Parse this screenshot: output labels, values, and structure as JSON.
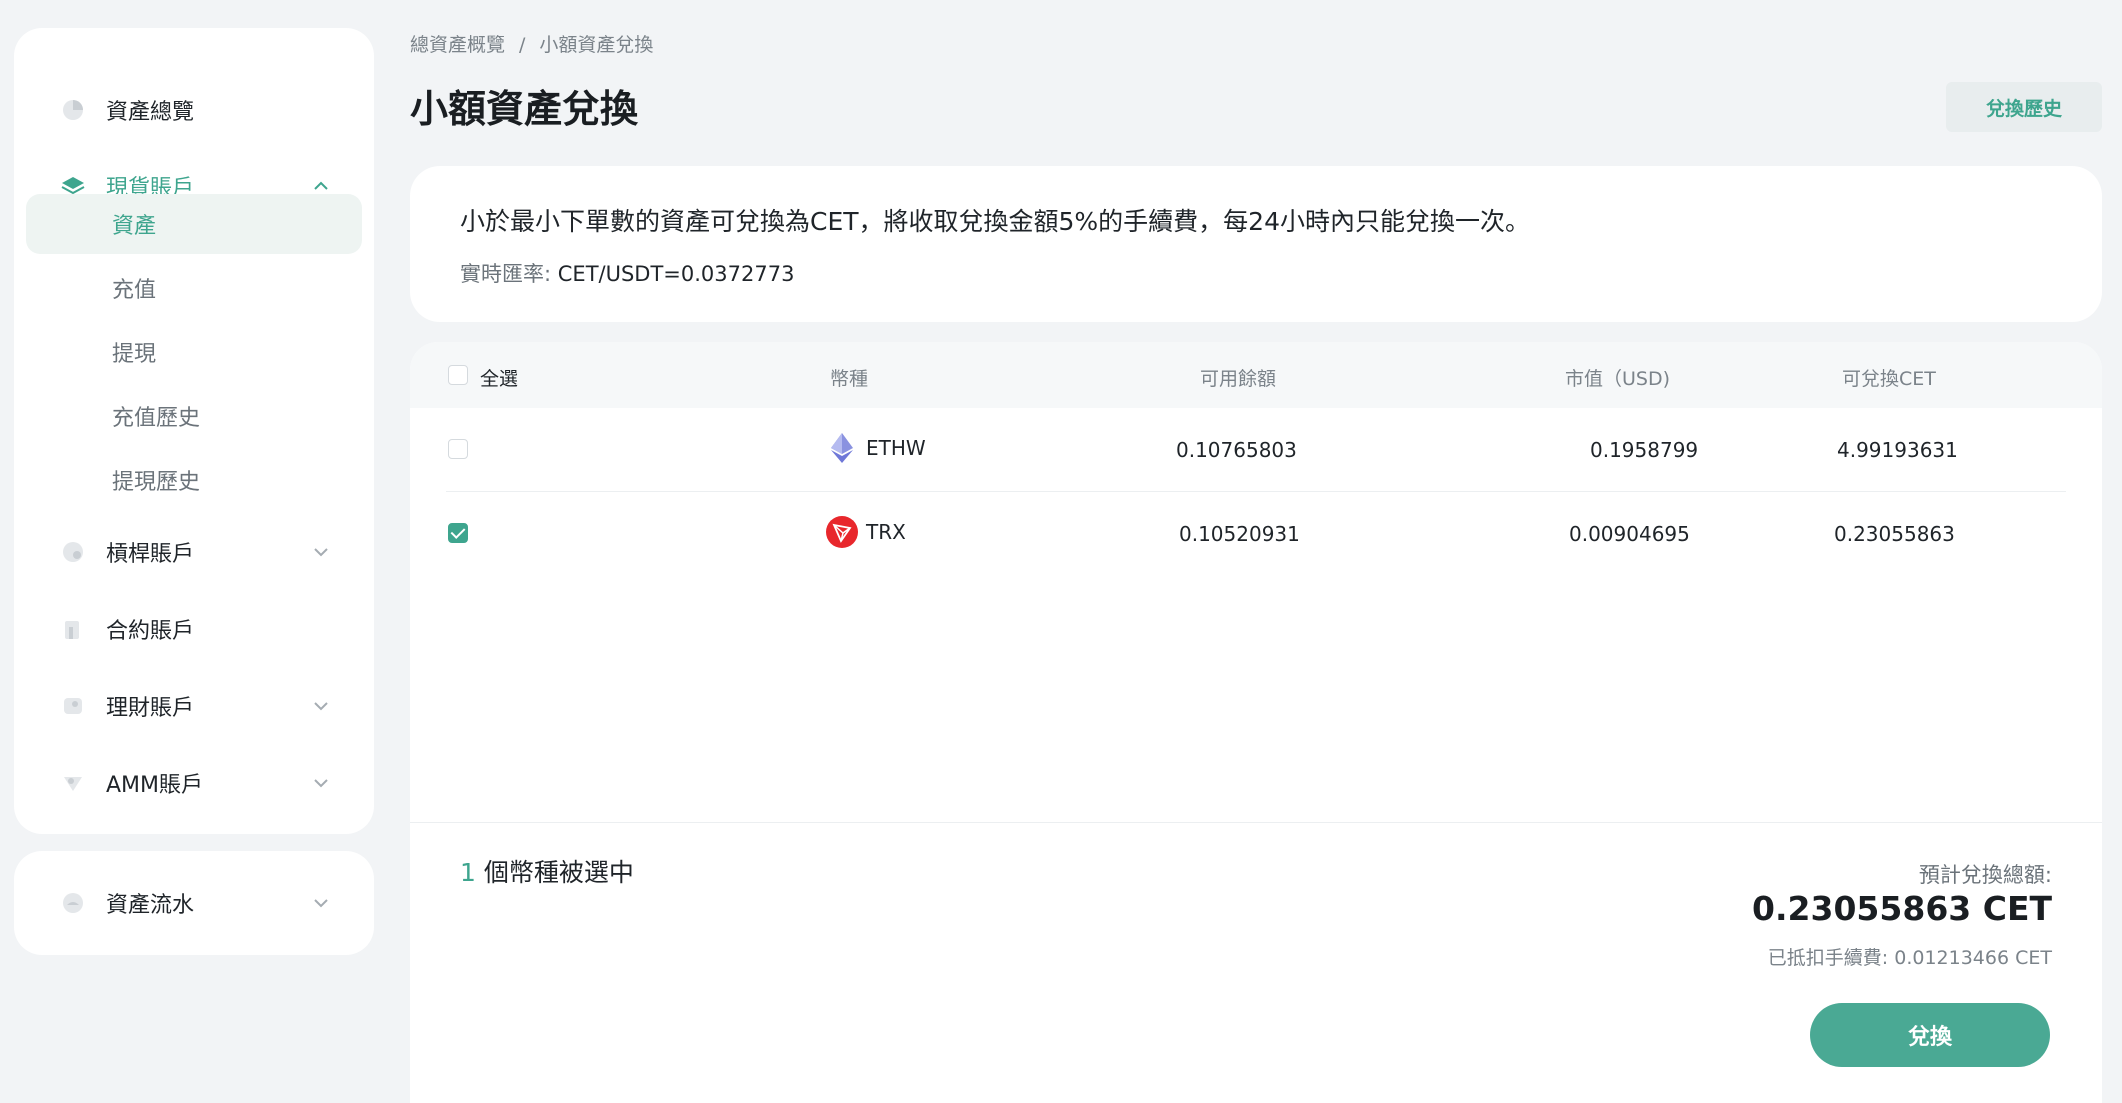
{
  "sidebar": {
    "items": [
      {
        "label": "資產總覽",
        "icon": "pie-chart-icon"
      },
      {
        "label": "現貨賬戶",
        "icon": "layers-icon",
        "active": true,
        "expanded": true
      },
      {
        "label": "槓桿賬戶",
        "icon": "margin-icon"
      },
      {
        "label": "合約賬戶",
        "icon": "contract-icon"
      },
      {
        "label": "理財賬戶",
        "icon": "finance-icon"
      },
      {
        "label": "AMM賬戶",
        "icon": "amm-icon"
      }
    ],
    "sub_items": [
      "資產",
      "充值",
      "提現",
      "充值歷史",
      "提現歷史"
    ],
    "flow": {
      "label": "資產流水",
      "icon": "flow-icon"
    }
  },
  "breadcrumb": {
    "parent": "總資產概覽",
    "separator": "/",
    "current": "小額資產兌換"
  },
  "page_title": "小額資產兌換",
  "history_button": "兌換歷史",
  "info": {
    "notice": "小於最小下單數的資產可兌換為CET，將收取兌換金額5%的手續費，每24小時內只能兌換一次。",
    "rate_label": "實時匯率:",
    "rate_value": "CET/USDT=0.0372773"
  },
  "table": {
    "headers": {
      "select_all": "全選",
      "coin": "幣種",
      "available": "可用餘額",
      "market_value": "市值（USD)",
      "convertible": "可兌換CET"
    },
    "rows": [
      {
        "coin": "ETHW",
        "available": "0.10765803",
        "market_value": "0.1958799",
        "convertible": "4.99193631",
        "checked": false
      },
      {
        "coin": "TRX",
        "available": "0.10520931",
        "market_value": "0.00904695",
        "convertible": "0.23055863",
        "checked": true
      }
    ]
  },
  "summary": {
    "count": "1",
    "count_suffix": "個幣種被選中",
    "est_label": "預計兌換總額:",
    "est_total": "0.23055863 CET",
    "fee": "已抵扣手續費: 0.01213466 CET",
    "convert_button": "兌換"
  },
  "colors": {
    "accent": "#3ea58e",
    "button": "#4aa994",
    "trx": "#e8272c",
    "background": "#f2f4f6"
  }
}
